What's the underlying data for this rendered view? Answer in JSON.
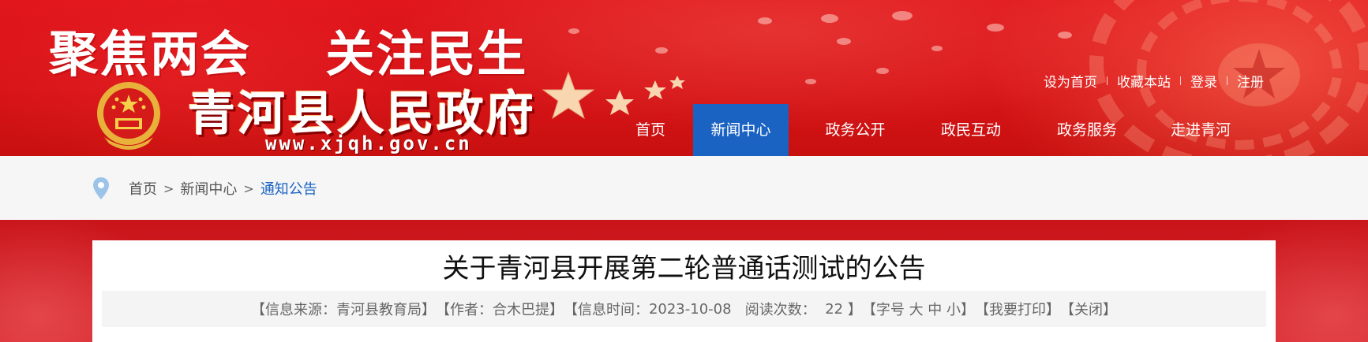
{
  "header": {
    "slogan": "聚焦两会    关注民生",
    "site_title": "青河县人民政府",
    "site_url": "www.xjqh.gov.cn",
    "colors": {
      "banner_red": "#d81418",
      "nav_active": "#1a63c2"
    },
    "emblem_icon": "national-emblem-icon",
    "toplinks": [
      "设为首页",
      "收藏本站",
      "登录",
      "注册"
    ]
  },
  "nav": {
    "items": [
      {
        "label": "首页",
        "active": false
      },
      {
        "label": "新闻中心",
        "active": true
      },
      {
        "label": "政务公开",
        "active": false
      },
      {
        "label": "政民互动",
        "active": false
      },
      {
        "label": "政务服务",
        "active": false
      },
      {
        "label": "走进青河",
        "active": false
      }
    ]
  },
  "breadcrumb": {
    "icon": "location-pin-icon",
    "items": [
      "首页",
      "新闻中心",
      "通知公告"
    ],
    "separator": ">"
  },
  "article": {
    "title": "关于青河县开展第二轮普通话测试的公告",
    "meta": {
      "source": "【信息来源：青河县教育局】",
      "author": "【作者：合木巴提】",
      "time_label": "【信息时间：",
      "time_value": "2023-10-08",
      "read_label": "阅读次数：",
      "read_count": "22",
      "read_close": "】",
      "font_open": "【字号",
      "font_large": "大",
      "font_medium": "中",
      "font_small": "小",
      "font_close": "】",
      "print": "【我要打印】",
      "close": "【关闭】"
    }
  }
}
